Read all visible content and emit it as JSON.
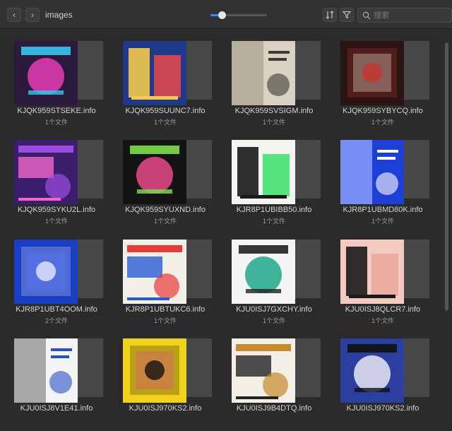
{
  "toolbar": {
    "back_label": "‹",
    "forward_label": "›",
    "folder_title": "images",
    "zoom_level": 0.2,
    "sort_icon": "sort-icon",
    "filter_icon": "filter-icon",
    "search_placeholder": "搜索"
  },
  "items": [
    {
      "name": "KJQK959STSEKE.info",
      "count": "1个文件",
      "colors": [
        "#2a1b3d",
        "#e63cb4",
        "#39c4f0"
      ]
    },
    {
      "name": "KJQK959SUUNC7.info",
      "count": "1个文件",
      "colors": [
        "#1f3a8a",
        "#f2c94c",
        "#e84a4a"
      ]
    },
    {
      "name": "KJQK959SVSIGM.info",
      "count": "1个文件",
      "colors": [
        "#d8d2c2",
        "#3d3a35",
        "#a8a08e"
      ]
    },
    {
      "name": "KJQK959SYBYCQ.info",
      "count": "1个文件",
      "colors": [
        "#2a1414",
        "#c9342c",
        "#e8e0d8"
      ]
    },
    {
      "name": "KJQK959SYKU2L.info",
      "count": "1个文件",
      "colors": [
        "#3b1f6e",
        "#9c4de0",
        "#f067c8"
      ]
    },
    {
      "name": "KJQK959SYUXND.info",
      "count": "1个文件",
      "colors": [
        "#141414",
        "#e84a8a",
        "#7ee04a"
      ]
    },
    {
      "name": "KJR8P1UBIBB50.info",
      "count": "1个文件",
      "colors": [
        "#f4f4f0",
        "#1a1a1a",
        "#3be06a"
      ]
    },
    {
      "name": "KJR8P1UBMD80K.info",
      "count": "1个文件",
      "colors": [
        "#1e3fd6",
        "#ffffff",
        "#9bb0ff"
      ]
    },
    {
      "name": "KJR8P1UBT4OOM.info",
      "count": "2个文件",
      "colors": [
        "#1b3fc4",
        "#e8eaff",
        "#5b7cff"
      ]
    },
    {
      "name": "KJR8P1UBTUKC6.info",
      "count": "1个文件",
      "colors": [
        "#f2efe6",
        "#e83a3a",
        "#2a5bd6"
      ]
    },
    {
      "name": "KJU0ISJ7GXCHY.info",
      "count": "1个文件",
      "colors": [
        "#f4f6f4",
        "#1fa88a",
        "#222222"
      ]
    },
    {
      "name": "KJU0ISJ8QLCR7.info",
      "count": "1个文件",
      "colors": [
        "#f4c9c0",
        "#1a1a1a",
        "#e8a898"
      ]
    },
    {
      "name": "KJU0ISJ8V1E41.info",
      "count": "",
      "colors": [
        "#f4f4f4",
        "#2a4fc4",
        "#888888"
      ]
    },
    {
      "name": "KJU0ISJ970KS2.info",
      "count": "",
      "colors": [
        "#f0d21a",
        "#111111",
        "#e84a8a"
      ]
    },
    {
      "name": "KJU0ISJ9B4DTQ.info",
      "count": "",
      "colors": [
        "#f4efe6",
        "#c88a2a",
        "#222222"
      ]
    },
    {
      "name": "KJU0ISJ970KS2.info",
      "count": "",
      "colors": [
        "#2a3fa0",
        "#e8e8f0",
        "#111111"
      ]
    }
  ]
}
